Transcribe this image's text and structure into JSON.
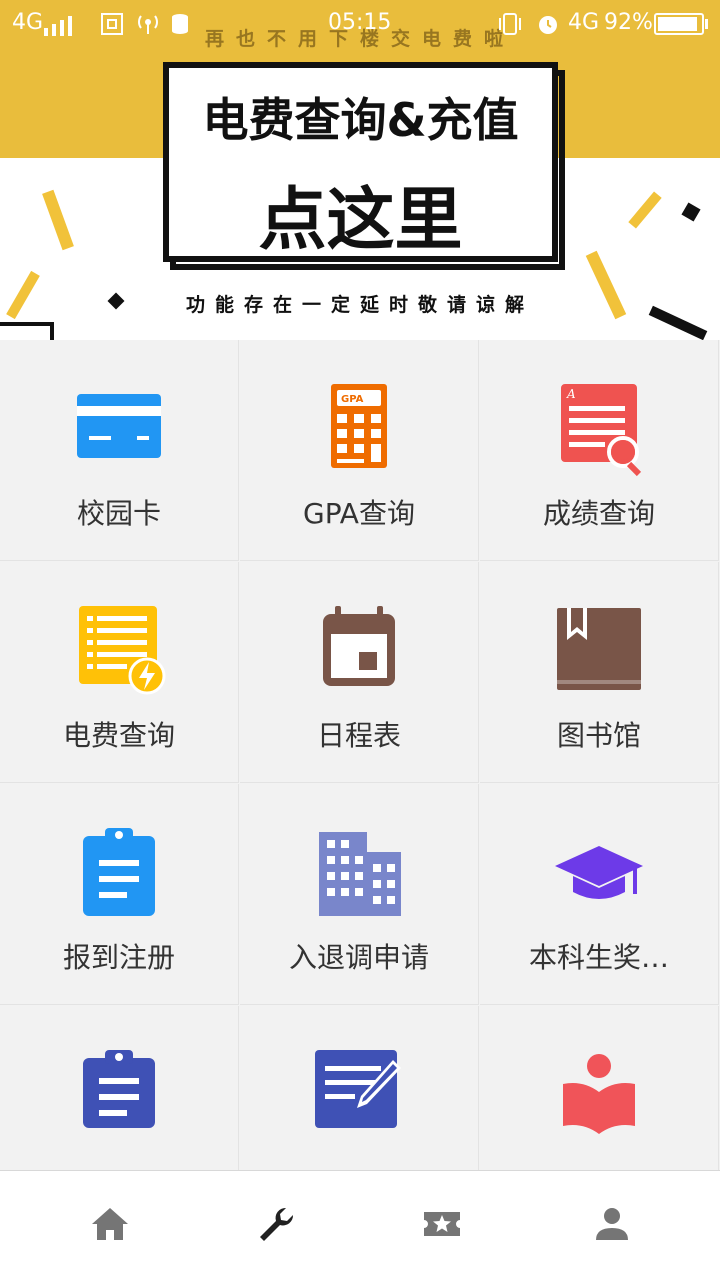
{
  "status_bar": {
    "network_left": "4G",
    "time": "05:15",
    "network_right": "4G",
    "battery": "92%",
    "battery_level": 0.92
  },
  "banner": {
    "top_text": "再也不用下楼交电费啦",
    "title": "电费查询&充值",
    "cta": "点这里",
    "bottom_text": "功能存在一定延时敬请谅解"
  },
  "grid": {
    "items": [
      {
        "label": "校园卡",
        "icon": "card-icon",
        "color": "#2196f3"
      },
      {
        "label": "GPA查询",
        "icon": "calculator-icon",
        "color": "#ef6c00",
        "icon_text": "GPA"
      },
      {
        "label": "成绩查询",
        "icon": "grade-search-icon",
        "color": "#ef5350",
        "icon_text": "A"
      },
      {
        "label": "电费查询",
        "icon": "electricity-bill-icon",
        "color": "#ffc107"
      },
      {
        "label": "日程表",
        "icon": "calendar-icon",
        "color": "#795548"
      },
      {
        "label": "图书馆",
        "icon": "book-icon",
        "color": "#795548"
      },
      {
        "label": "报到注册",
        "icon": "clipboard-icon",
        "color": "#2196f3"
      },
      {
        "label": "入退调申请",
        "icon": "building-icon",
        "color": "#7986cb"
      },
      {
        "label": "本科生奖…",
        "icon": "graduation-cap-icon",
        "color": "#6d3ae8"
      },
      {
        "label": "",
        "icon": "clipboard-icon",
        "color": "#3f51b5"
      },
      {
        "label": "",
        "icon": "edit-note-icon",
        "color": "#3f51b5"
      },
      {
        "label": "",
        "icon": "reading-icon",
        "color": "#f05459"
      }
    ]
  },
  "bottom_nav": {
    "items": [
      {
        "icon": "home-icon",
        "color": "#757575"
      },
      {
        "icon": "wrench-icon",
        "color": "#212121"
      },
      {
        "icon": "ticket-star-icon",
        "color": "#757575"
      },
      {
        "icon": "person-icon",
        "color": "#757575"
      }
    ]
  }
}
